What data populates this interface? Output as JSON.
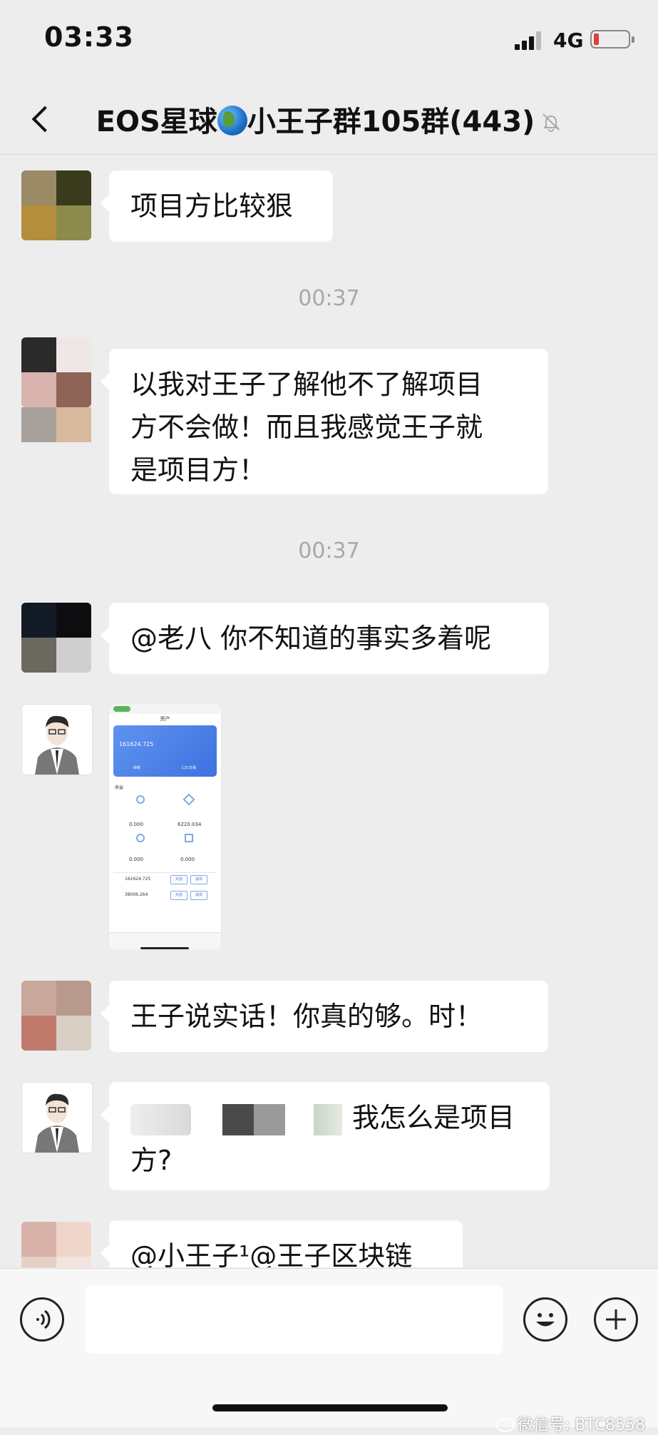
{
  "status": {
    "time": "03:33",
    "network": "4G"
  },
  "header": {
    "title_prefix": "EOS星球",
    "title_suffix": "小王子群105群(443)"
  },
  "messages": {
    "m1": "项目方比较狠",
    "ts1": "00:37",
    "m2_l1": "以我对王子了解他不了解项目",
    "m2_l2": "方不会做！而且我感觉王子就",
    "m2_l3": "是项目方！",
    "ts2": "00:37",
    "m3": "@老八 你不知道的事实多着呢",
    "m4": "王子说实话！你真的够。时！",
    "m5_l1": "我怎么是项目",
    "m5_l2": "方?",
    "m6": "@小王子¹@王子区块链"
  },
  "shared_image": {
    "title": "资产",
    "balance": "161624.725",
    "btn1": "转账",
    "btn2": "C2C交易",
    "section": "收益",
    "v1": "0.000",
    "v2": "6220.034",
    "v3": "0.000",
    "v4": "0.000",
    "row1": "161624.725",
    "row2": "38006.264",
    "chip1": "充值",
    "chip2": "提现"
  },
  "watermark": "微信号: BTC8558",
  "icons": {
    "back": "chevron-left-icon",
    "mute": "bell-off-icon",
    "voice": "voice-icon",
    "emoji": "emoji-icon",
    "add": "plus-icon"
  }
}
